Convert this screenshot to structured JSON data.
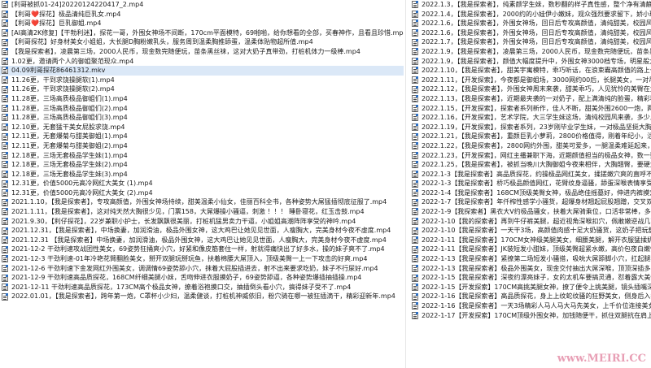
{
  "left_files": [
    "[利哥被抓01-24]20220124220417_2.mp4",
    "【利哥❤️探花】极品清纯巨乳女.mp4",
    "【利哥❤️探花】巨乳御姐.mp4",
    "[AI高清2K修复]【干勃利迷】，探花一哥，外围女神场不间断，170cm平面模特，69啪啪，给你想看的全部，买春神作，且看且珍惜.mp4",
    "【利哥探花】好身材美女小姐姐，大长腿D胸粉嫩乳头，服务周到温柔胸推舔蛋，温柔体贴物超所值.mp4",
    "【我是探索者】，凌晨第三场，2000人民币，现金数完随便玩，苗条黑丝袜，这对大奶子真带劲，打桩机体力一级棒.mp4",
    "1.02更，邀请两个人的御姐聚范现众.mp4",
    "04.09利哥探花86461312.mkv",
    "11.26更，干到求饶操腿软(1).mp4",
    "11.26更，干到求饶操腿软(2).mp4",
    "11.28更，三场高质极品御姐们(1).mp4",
    "11.28更，三场高质极品御姐们(2).mp4",
    "11.28更，三场高质极品御姐们(3).mp4",
    "12.10更，无套猛干美女屁股求饶.mp4",
    "12.11更，无套爆菊与甜美御姐(1).mp4",
    "12.11更，无套爆菊与甜美御姐(2).mp4",
    "12.18更，三场无套极品学生妹(1).mp4",
    "12.18更，三场无套极品学生妹(2).mp4",
    "12.18更，三场无套极品学生妹(3).mp4",
    "12.31更，价值5000元高冷网红大美女 (1).mp4",
    "12.31更，价值5000元高冷网红大美女 (2).mp4",
    "2021.1.10，【我是探索者】，专攻高颜值，外围女神场持续，甜美温柔小仙女，佳丽百科全书，各种姿势大屌猛插彻底征服了.mp4",
    "2021.1.11，【我是探索者】，这对纯天然大胸很少见，门票158，大屌爆操小骚逼，刺激 ！！！ 睡卧寝花，红玉击鼓.mp4",
    "2021.9.30，【利仔探花】，22岁兼职小护士，长发飘飘很美丽，打桩机猛男卖力干逼，小姐姐高潮阵阵享受的神吟.mp4",
    "2021.12.31，【我是探索者】，中场换妻，加润滑油，极品外围女神，这大鸡巴让她见见世面，人瘦胸大，完美身材今夜不虚度.mp4",
    "2021.12.31 【我是探索者】中场换妻，加润滑油，极品外围女神，这大鸡巴让她见见世面，人瘦胸大，完美身材今夜不虚度.mp4",
    "2021-12-2 干劲利速攻战团性美女，69姿势狂捅爽小穴，好紧和像皮筋套住一样，射就得痛快出了好多水，操的妹子爽不了.mp4",
    "2021-12-3 干劲利速-01年冷艳花臂翻脸美女，掰开双腿玩掰玩鱼，扶着棉腰大屌顶入，顶级美臀一上一下攻击的好爽.mp4",
    "2021-12-6 干劲利速下金发网红外围美女，调调情69姿势舔小穴，抹着大屁股插进去，射不出来要求吃奶，妹子不行尿好.mp4",
    "2021-12-9 干劲利速高品质探花，168CM纤细美腿小妹，舌吻伸进衣服摸奶子，69姿势舔逼，各种姿势爆插抽插操.mp4",
    "2021-12-11 干劲利速高品质探花，173CM高个极品女神，撩着浴袍摸口交，抽插倒头看小穴，搞得妹子受不了.mp4",
    "2022.01.01，【我是探索者】，跨年第一炮，C罩杯小少妇，温柔健谈，打桩机神威依旧，粉穴骑在哪一被狂插滴干，精彩迎新年.mp4"
  ],
  "right_files": [
    "2022.1.3，【我是探索者】，纯素颜学生妹，数秒翻的样子真性感，整个净有清静，一",
    "2022.1.4，【我是探索者】，2000约的小娃伊小嫩妹，观众强烈要求留下，娇小玲珑还",
    "2022.1.6，【我是探索者】，外围女神场，回日后专攻高颜值，清纯甜美，校园风小",
    "2022.1.6，【我是探索者】，外围女神场，回日后专攻高颜值，清纯甜美，校园风小",
    "2022.1.7，【我是探索者】，外围女神场，回日后专攻高颜值，清纯甜美，校园风小",
    "2022.1.9，【我是探索者】，凌晨第三场，2000人民币，现金数完随便玩，苗条黑丝",
    "2022.1.9，【我是探索者】，颜值大幅度提升中，外围女神3000档专场，明星般大美",
    "2022.1.10，【我是探索者】，甜美宇寓模特，乖巧听话，在浪束霸高颜值的路上一发",
    "2022.1.11，【开发探索】，今夜都是御姐场，3000网约00后，长腿美女，一对吊钟大",
    "2022.1.12，【我是探索者】，外围女神周末来袭，甜美乖巧，人见犹怜的美臀在大骗",
    "2022.1.13，【我是探索者】，近期最夹袭的一对奶子，配上满清纯的脸蛋，精彩程度再度",
    "2022.1.15，【开发探索】，探索者系列新作，佳人不断，甜美外围2600一炮，两大女",
    "2022.1.16，【开发探索】，艺术学院，大三学生妹这场，清纯校园风来袭，多少人的",
    "2022.1.19，【开发探索】，探索者系列，23岁刚毕业学生妹，一对极品坚挺大胸，好",
    "2022.1.21，【我是探索者】，重颜巨乳小萝莉，2800价格值得，刚着年纪小，活不错",
    "2022.1.22，【我是探索者】，2800网约外围，甜美可爱多，一腿温柔难延起来，白衣托",
    "2022.1.23，【开发探索】，网红主播兼职下海，近期颜值担当的极品女神，数一数二",
    "2022.1.25，【我是探索者】，被抓当晚川大胸御姐今夜来相伴，大胸翘臀，要硬大哥",
    "2022.1-3【我是探索者】高品质探花，约操极品网红美女，揉搓嫩穴爽的直呼不要",
    "2022-1-3【我是探索者】桥巧极品颜值网红，花臂纹身逼骚，舔蛋深喉表情享受，发猫",
    "2022-1-4【我是探索者】168CM顶级美臀女神，极品绝佳摇墓好，伸进内裤摸穴，掰起说",
    "2022-1-7【我是探索者】年仟榨性感学小骚货，超爆身材翘起屁股翘蹭，交叉双腿后入",
    "2022-1-9【我探索者】黑衣大V约极品骚女，扶着大屌骑乘位，口活非常棒，多毛骚穴",
    "2022-1-10【我的探索者】再到牛仔裤美腿，超近视角深喉扣穴，佩敢嫩逆战几下就爽射",
    "2022-1-10【我是探索者】一天干3场，高颜值肉感十足大奶骚货，这奶子把玩舒爽，舔吸",
    "2022-1-11【我是探索者】170CM女神级美腿美女，细腰美腿，解开衣服猛揉奶，双腿扛",
    "2022-1-11【我是探索者】JK装短发小甜妹，顶级美臀超紧水嫩，高价包夜白嫩性感尊",
    "2022-1-13【我是探索者】紧撩第二场短发小骚搭，吸吮大屌舔脚小穴，扛起腿狠爽",
    "2022-1-13【我是探索者】极品外围美女，现金交付抽出大屌深喉，顶顶深插多毛骚",
    "2022-1-15【我是探索者】深夜约漂亮妹子，女的太机车要搞灵通，怼着露大美性骚抽",
    "2022-1-15【开发探索】170CM高挑美腿女神，撩了便令上挑美腿，镜头插嘴深喉，顶",
    "2022-1-16【我是探索者】高品质探花，身上上纹蛇纹骚的狂野美女，侧身后入往上干穿",
    "2022-1-16【我是探索者】一天3场精彩人马人马大马先美女，上千价位连接美女大性",
    "2022-1-17【开发探索】170CM顶级外围女神，加钱随便干，抓住双腿抗在肩上，"
  ],
  "watermark": "www.MEIRI.CC"
}
